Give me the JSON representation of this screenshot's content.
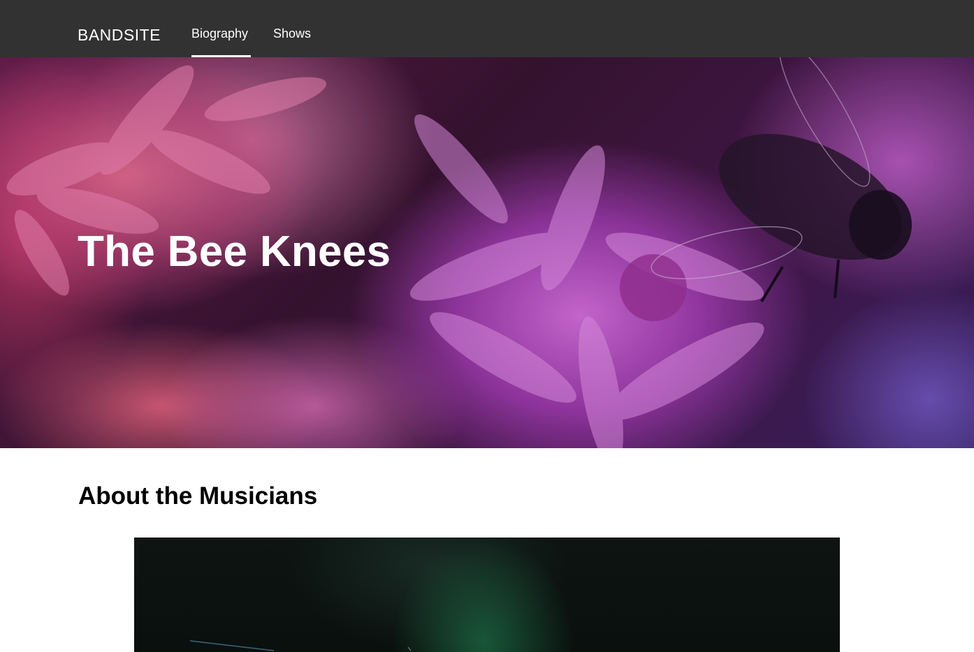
{
  "nav": {
    "logo": "BANDSITE",
    "links": [
      {
        "label": "Biography",
        "active": true
      },
      {
        "label": "Shows",
        "active": false
      }
    ]
  },
  "hero": {
    "title": "The Bee Knees"
  },
  "about": {
    "heading": "About the Musicians"
  },
  "colors": {
    "nav_background": "#323232",
    "text_light": "#ffffff",
    "text_dark": "#000000"
  }
}
